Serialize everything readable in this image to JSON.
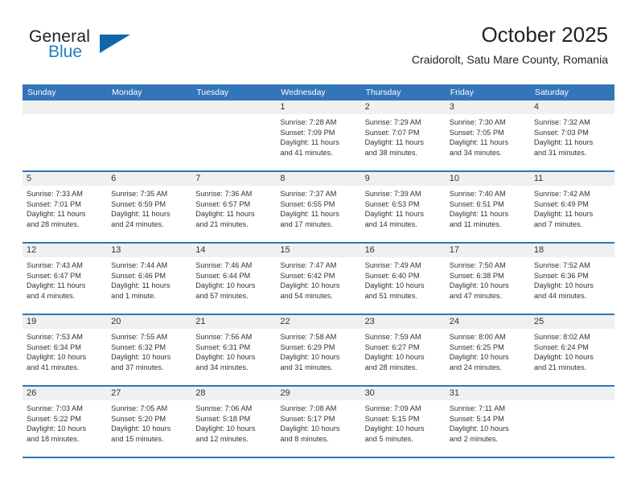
{
  "brand": {
    "name_part1": "General",
    "name_part2": "Blue",
    "triangle_color": "#1166aa",
    "blue_color": "#1f7ec4"
  },
  "header": {
    "title": "October 2025",
    "subtitle": "Craidorolt, Satu Mare County, Romania"
  },
  "theme": {
    "header_row_bg": "#3275b9",
    "daynum_band_bg": "#f0f0f0",
    "grid_line": "#3275b9",
    "text": "#333333"
  },
  "weekday_headers": [
    "Sunday",
    "Monday",
    "Tuesday",
    "Wednesday",
    "Thursday",
    "Friday",
    "Saturday"
  ],
  "weeks": [
    [
      {
        "day": "",
        "sunrise": "",
        "sunset": "",
        "daylight_line1": "",
        "daylight_line2": ""
      },
      {
        "day": "",
        "sunrise": "",
        "sunset": "",
        "daylight_line1": "",
        "daylight_line2": ""
      },
      {
        "day": "",
        "sunrise": "",
        "sunset": "",
        "daylight_line1": "",
        "daylight_line2": ""
      },
      {
        "day": "1",
        "sunrise": "Sunrise: 7:28 AM",
        "sunset": "Sunset: 7:09 PM",
        "daylight_line1": "Daylight: 11 hours",
        "daylight_line2": "and 41 minutes."
      },
      {
        "day": "2",
        "sunrise": "Sunrise: 7:29 AM",
        "sunset": "Sunset: 7:07 PM",
        "daylight_line1": "Daylight: 11 hours",
        "daylight_line2": "and 38 minutes."
      },
      {
        "day": "3",
        "sunrise": "Sunrise: 7:30 AM",
        "sunset": "Sunset: 7:05 PM",
        "daylight_line1": "Daylight: 11 hours",
        "daylight_line2": "and 34 minutes."
      },
      {
        "day": "4",
        "sunrise": "Sunrise: 7:32 AM",
        "sunset": "Sunset: 7:03 PM",
        "daylight_line1": "Daylight: 11 hours",
        "daylight_line2": "and 31 minutes."
      }
    ],
    [
      {
        "day": "5",
        "sunrise": "Sunrise: 7:33 AM",
        "sunset": "Sunset: 7:01 PM",
        "daylight_line1": "Daylight: 11 hours",
        "daylight_line2": "and 28 minutes."
      },
      {
        "day": "6",
        "sunrise": "Sunrise: 7:35 AM",
        "sunset": "Sunset: 6:59 PM",
        "daylight_line1": "Daylight: 11 hours",
        "daylight_line2": "and 24 minutes."
      },
      {
        "day": "7",
        "sunrise": "Sunrise: 7:36 AM",
        "sunset": "Sunset: 6:57 PM",
        "daylight_line1": "Daylight: 11 hours",
        "daylight_line2": "and 21 minutes."
      },
      {
        "day": "8",
        "sunrise": "Sunrise: 7:37 AM",
        "sunset": "Sunset: 6:55 PM",
        "daylight_line1": "Daylight: 11 hours",
        "daylight_line2": "and 17 minutes."
      },
      {
        "day": "9",
        "sunrise": "Sunrise: 7:39 AM",
        "sunset": "Sunset: 6:53 PM",
        "daylight_line1": "Daylight: 11 hours",
        "daylight_line2": "and 14 minutes."
      },
      {
        "day": "10",
        "sunrise": "Sunrise: 7:40 AM",
        "sunset": "Sunset: 6:51 PM",
        "daylight_line1": "Daylight: 11 hours",
        "daylight_line2": "and 11 minutes."
      },
      {
        "day": "11",
        "sunrise": "Sunrise: 7:42 AM",
        "sunset": "Sunset: 6:49 PM",
        "daylight_line1": "Daylight: 11 hours",
        "daylight_line2": "and 7 minutes."
      }
    ],
    [
      {
        "day": "12",
        "sunrise": "Sunrise: 7:43 AM",
        "sunset": "Sunset: 6:47 PM",
        "daylight_line1": "Daylight: 11 hours",
        "daylight_line2": "and 4 minutes."
      },
      {
        "day": "13",
        "sunrise": "Sunrise: 7:44 AM",
        "sunset": "Sunset: 6:46 PM",
        "daylight_line1": "Daylight: 11 hours",
        "daylight_line2": "and 1 minute."
      },
      {
        "day": "14",
        "sunrise": "Sunrise: 7:46 AM",
        "sunset": "Sunset: 6:44 PM",
        "daylight_line1": "Daylight: 10 hours",
        "daylight_line2": "and 57 minutes."
      },
      {
        "day": "15",
        "sunrise": "Sunrise: 7:47 AM",
        "sunset": "Sunset: 6:42 PM",
        "daylight_line1": "Daylight: 10 hours",
        "daylight_line2": "and 54 minutes."
      },
      {
        "day": "16",
        "sunrise": "Sunrise: 7:49 AM",
        "sunset": "Sunset: 6:40 PM",
        "daylight_line1": "Daylight: 10 hours",
        "daylight_line2": "and 51 minutes."
      },
      {
        "day": "17",
        "sunrise": "Sunrise: 7:50 AM",
        "sunset": "Sunset: 6:38 PM",
        "daylight_line1": "Daylight: 10 hours",
        "daylight_line2": "and 47 minutes."
      },
      {
        "day": "18",
        "sunrise": "Sunrise: 7:52 AM",
        "sunset": "Sunset: 6:36 PM",
        "daylight_line1": "Daylight: 10 hours",
        "daylight_line2": "and 44 minutes."
      }
    ],
    [
      {
        "day": "19",
        "sunrise": "Sunrise: 7:53 AM",
        "sunset": "Sunset: 6:34 PM",
        "daylight_line1": "Daylight: 10 hours",
        "daylight_line2": "and 41 minutes."
      },
      {
        "day": "20",
        "sunrise": "Sunrise: 7:55 AM",
        "sunset": "Sunset: 6:32 PM",
        "daylight_line1": "Daylight: 10 hours",
        "daylight_line2": "and 37 minutes."
      },
      {
        "day": "21",
        "sunrise": "Sunrise: 7:56 AM",
        "sunset": "Sunset: 6:31 PM",
        "daylight_line1": "Daylight: 10 hours",
        "daylight_line2": "and 34 minutes."
      },
      {
        "day": "22",
        "sunrise": "Sunrise: 7:58 AM",
        "sunset": "Sunset: 6:29 PM",
        "daylight_line1": "Daylight: 10 hours",
        "daylight_line2": "and 31 minutes."
      },
      {
        "day": "23",
        "sunrise": "Sunrise: 7:59 AM",
        "sunset": "Sunset: 6:27 PM",
        "daylight_line1": "Daylight: 10 hours",
        "daylight_line2": "and 28 minutes."
      },
      {
        "day": "24",
        "sunrise": "Sunrise: 8:00 AM",
        "sunset": "Sunset: 6:25 PM",
        "daylight_line1": "Daylight: 10 hours",
        "daylight_line2": "and 24 minutes."
      },
      {
        "day": "25",
        "sunrise": "Sunrise: 8:02 AM",
        "sunset": "Sunset: 6:24 PM",
        "daylight_line1": "Daylight: 10 hours",
        "daylight_line2": "and 21 minutes."
      }
    ],
    [
      {
        "day": "26",
        "sunrise": "Sunrise: 7:03 AM",
        "sunset": "Sunset: 5:22 PM",
        "daylight_line1": "Daylight: 10 hours",
        "daylight_line2": "and 18 minutes."
      },
      {
        "day": "27",
        "sunrise": "Sunrise: 7:05 AM",
        "sunset": "Sunset: 5:20 PM",
        "daylight_line1": "Daylight: 10 hours",
        "daylight_line2": "and 15 minutes."
      },
      {
        "day": "28",
        "sunrise": "Sunrise: 7:06 AM",
        "sunset": "Sunset: 5:18 PM",
        "daylight_line1": "Daylight: 10 hours",
        "daylight_line2": "and 12 minutes."
      },
      {
        "day": "29",
        "sunrise": "Sunrise: 7:08 AM",
        "sunset": "Sunset: 5:17 PM",
        "daylight_line1": "Daylight: 10 hours",
        "daylight_line2": "and 8 minutes."
      },
      {
        "day": "30",
        "sunrise": "Sunrise: 7:09 AM",
        "sunset": "Sunset: 5:15 PM",
        "daylight_line1": "Daylight: 10 hours",
        "daylight_line2": "and 5 minutes."
      },
      {
        "day": "31",
        "sunrise": "Sunrise: 7:11 AM",
        "sunset": "Sunset: 5:14 PM",
        "daylight_line1": "Daylight: 10 hours",
        "daylight_line2": "and 2 minutes."
      },
      {
        "day": "",
        "sunrise": "",
        "sunset": "",
        "daylight_line1": "",
        "daylight_line2": ""
      }
    ]
  ]
}
